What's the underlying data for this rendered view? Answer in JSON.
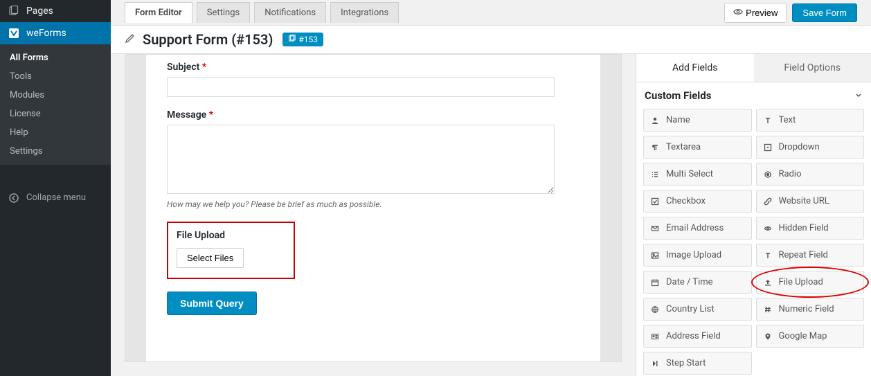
{
  "sidebar": {
    "pages_label": "Pages",
    "weforms_label": "weForms",
    "submenu": [
      {
        "label": "All Forms",
        "current": true
      },
      {
        "label": "Tools",
        "current": false
      },
      {
        "label": "Modules",
        "current": false
      },
      {
        "label": "License",
        "current": false
      },
      {
        "label": "Help",
        "current": false
      },
      {
        "label": "Settings",
        "current": false
      }
    ],
    "collapse_label": "Collapse menu"
  },
  "topbar": {
    "tabs": [
      {
        "label": "Form Editor",
        "active": true
      },
      {
        "label": "Settings",
        "active": false
      },
      {
        "label": "Notifications",
        "active": false
      },
      {
        "label": "Integrations",
        "active": false
      }
    ],
    "preview_label": "Preview",
    "save_label": "Save Form"
  },
  "title": {
    "form_name": "Support Form (#153)",
    "badge": "#153"
  },
  "canvas": {
    "subject_label": "Subject",
    "message_label": "Message",
    "message_hint": "How may we help you? Please be brief as much as possible.",
    "file_upload_label": "File Upload",
    "select_files_label": "Select Files",
    "submit_label": "Submit Query"
  },
  "right_panel": {
    "tab_add": "Add Fields",
    "tab_options": "Field Options",
    "section_title": "Custom Fields",
    "fields_col1": [
      {
        "icon": "user",
        "label": "Name"
      },
      {
        "icon": "para",
        "label": "Textarea"
      },
      {
        "icon": "list",
        "label": "Multi Select"
      },
      {
        "icon": "check",
        "label": "Checkbox"
      },
      {
        "icon": "mail",
        "label": "Email Address"
      },
      {
        "icon": "image",
        "label": "Image Upload"
      },
      {
        "icon": "cal",
        "label": "Date / Time"
      },
      {
        "icon": "globe",
        "label": "Country List"
      },
      {
        "icon": "card",
        "label": "Address Field"
      },
      {
        "icon": "step",
        "label": "Step Start"
      }
    ],
    "fields_col2": [
      {
        "icon": "text",
        "label": "Text"
      },
      {
        "icon": "caret",
        "label": "Dropdown"
      },
      {
        "icon": "dot",
        "label": "Radio"
      },
      {
        "icon": "link",
        "label": "Website URL"
      },
      {
        "icon": "eyeoff",
        "label": "Hidden Field"
      },
      {
        "icon": "text",
        "label": "Repeat Field"
      },
      {
        "icon": "upload",
        "label": "File Upload"
      },
      {
        "icon": "hash",
        "label": "Numeric Field"
      },
      {
        "icon": "pin",
        "label": "Google Map"
      }
    ]
  }
}
